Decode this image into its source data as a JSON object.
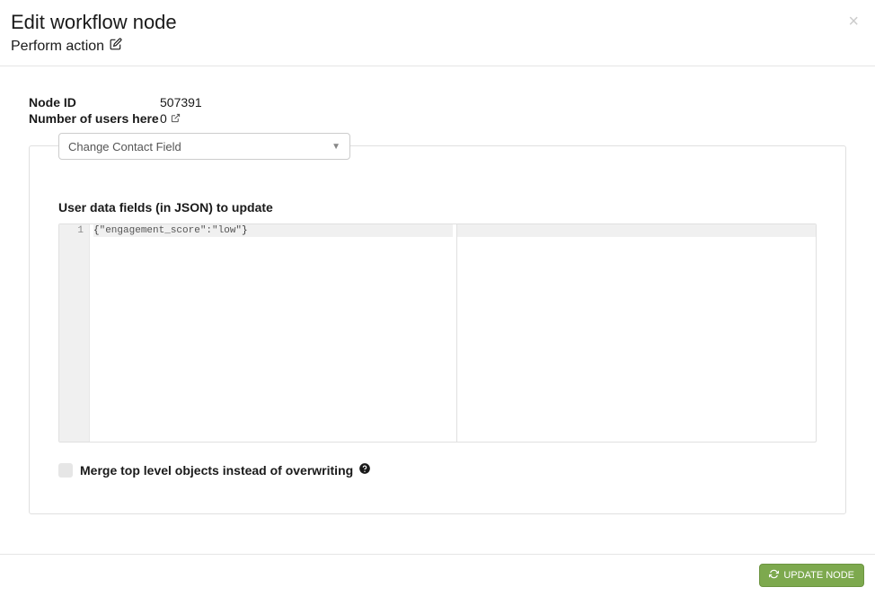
{
  "header": {
    "title": "Edit workflow node",
    "subtitle": "Perform action"
  },
  "info": {
    "node_id_label": "Node ID",
    "node_id_value": "507391",
    "users_label": "Number of users here",
    "users_value": "0"
  },
  "dropdown": {
    "selected": "Change Contact Field"
  },
  "editor": {
    "label": "User data fields (in JSON) to update",
    "line_number": "1",
    "code": "{\"engagement_score\":\"low\"}"
  },
  "checkbox": {
    "label": "Merge top level objects instead of overwriting"
  },
  "footer": {
    "update_button": "UPDATE NODE"
  }
}
